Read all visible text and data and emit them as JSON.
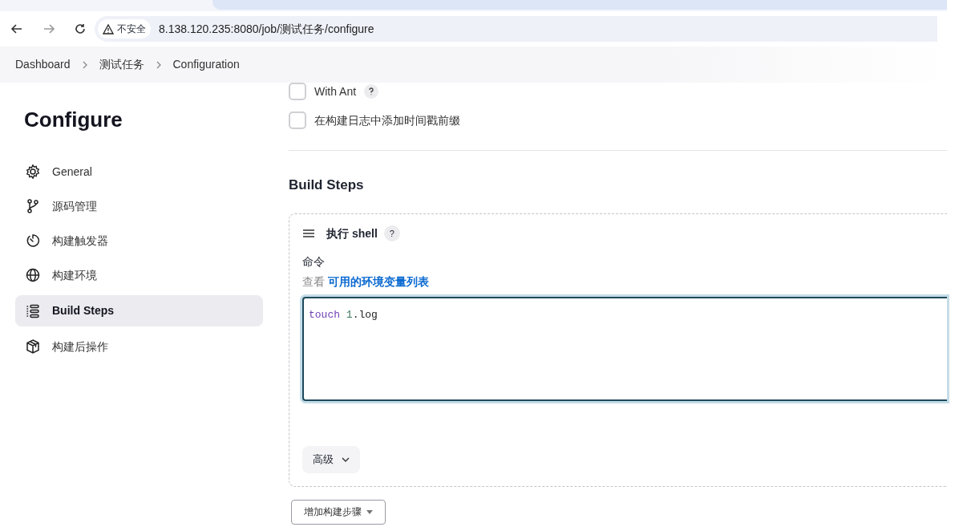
{
  "browser": {
    "security_label": "不安全",
    "url": "8.138.120.235:8080/job/测试任务/configure"
  },
  "breadcrumbs": [
    "Dashboard",
    "测试任务",
    "Configuration"
  ],
  "page_title": "Configure",
  "sidebar": {
    "items": [
      {
        "label": "General",
        "kind": "gear",
        "selected": false
      },
      {
        "label": "源码管理",
        "kind": "branch",
        "selected": false
      },
      {
        "label": "构建触发器",
        "kind": "timer",
        "selected": false
      },
      {
        "label": "构建环境",
        "kind": "globe",
        "selected": false
      },
      {
        "label": "Build Steps",
        "kind": "list",
        "selected": true
      },
      {
        "label": "构建后操作",
        "kind": "box",
        "selected": false
      }
    ]
  },
  "options": [
    {
      "label": "With Ant",
      "checked": false,
      "help": true
    },
    {
      "label": "在构建日志中添加时间戳前缀",
      "checked": false,
      "help": false
    }
  ],
  "section_title": "Build Steps",
  "step": {
    "title": "执行 shell",
    "help_label": "?",
    "field_label": "命令",
    "hint_prefix": "查看",
    "hint_link": "可用的环境变量列表",
    "code_tokens": [
      {
        "text": "touch",
        "kind": "keyword",
        "space_after": true
      },
      {
        "text": "1",
        "kind": "number",
        "space_after": false
      },
      {
        "text": ".log",
        "kind": "plain",
        "space_after": false
      }
    ],
    "advanced_button": "高级"
  },
  "add_step_button": "增加构建步骤"
}
